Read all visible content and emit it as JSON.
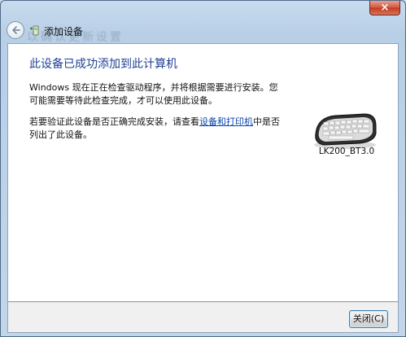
{
  "window": {
    "title": "添加设备",
    "close_glyph": "×"
  },
  "background_text": "以确认更新设置",
  "content": {
    "heading": "此设备已成功添加到此计算机",
    "para1": "Windows 现在正在检查驱动程序，并将根据需要进行安装。您可能需要等待此检查完成，才可以使用此设备。",
    "para2_before": "若要验证此设备是否正确完成安装，请查看",
    "para2_link": "设备和打印机",
    "para2_after": "中是否列出了此设备。"
  },
  "device": {
    "name": "LK200_BT3.0",
    "icon": "keyboard-icon"
  },
  "footer": {
    "close_label": "关闭(C)"
  },
  "icons": {
    "back": "back-arrow-icon",
    "title": "add-device-icon"
  },
  "colors": {
    "heading": "#1e3f96",
    "link": "#0645ad",
    "close_button": "#c23a22"
  }
}
